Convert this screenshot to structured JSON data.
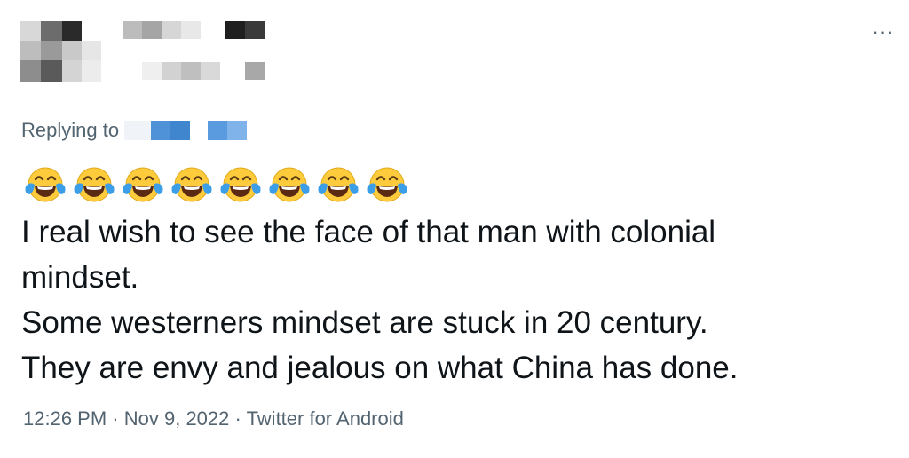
{
  "header": {
    "more_label": "···"
  },
  "reply": {
    "prefix": "Replying to"
  },
  "tweet": {
    "emoji_icon": "face-with-tears-of-joy-icon",
    "emoji_char": "😂",
    "emoji_count": 8,
    "lines": [
      "I real wish to see the face of that man with colonial",
      "mindset.",
      "Some westerners mindset are stuck in 20 century.",
      "They are envy and jealous on what China has done."
    ]
  },
  "meta": {
    "time": "12:26 PM",
    "separator": "·",
    "date": "Nov 9, 2022",
    "source": "Twitter for Android"
  },
  "colors": {
    "text": "#0f1419",
    "secondary": "#536471",
    "emoji_face": "#fdcb3b",
    "emoji_tears": "#3d9ee8"
  }
}
